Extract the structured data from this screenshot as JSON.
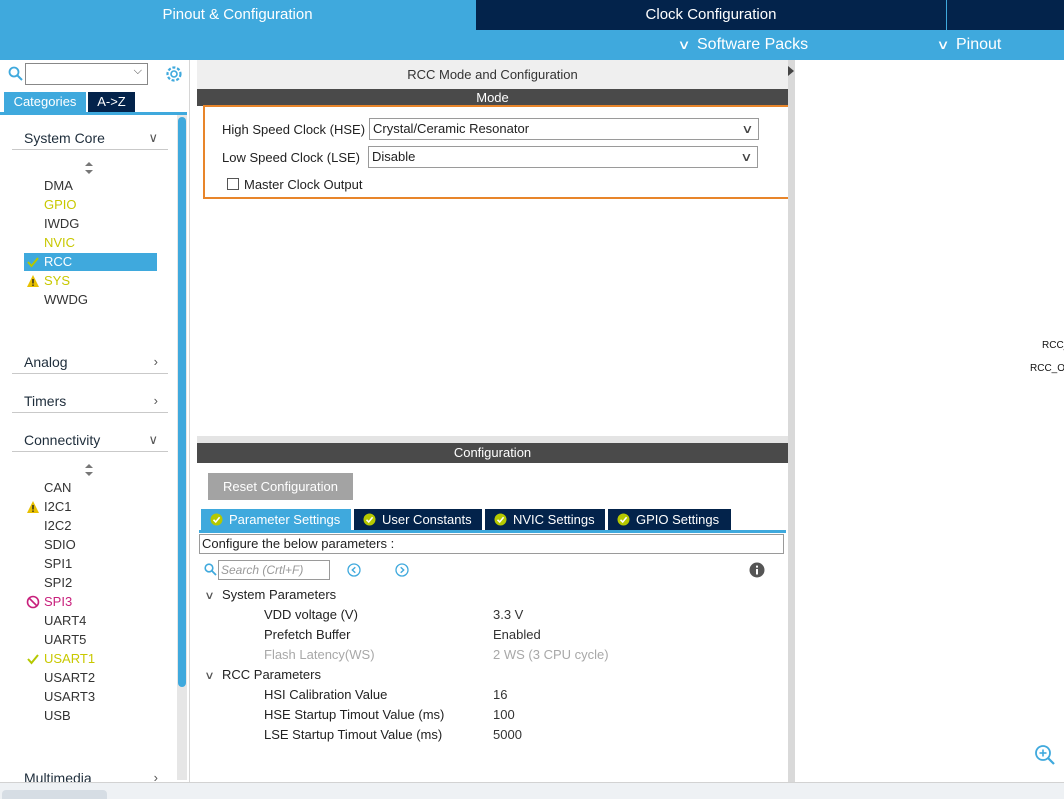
{
  "top_tabs": {
    "pinout": "Pinout & Configuration",
    "clock": "Clock Configuration"
  },
  "subnav": {
    "software_packs": "Software Packs",
    "pinout": "Pinout"
  },
  "left": {
    "categories_tab": "Categories",
    "az_tab": "A->Z",
    "system_core": {
      "title": "System Core",
      "items": [
        "DMA",
        "GPIO",
        "IWDG",
        "NVIC",
        "RCC",
        "SYS",
        "WWDG"
      ]
    },
    "analog": "Analog",
    "timers": "Timers",
    "connectivity": {
      "title": "Connectivity",
      "items": [
        "CAN",
        "I2C1",
        "I2C2",
        "SDIO",
        "SPI1",
        "SPI2",
        "SPI3",
        "UART4",
        "UART5",
        "USART1",
        "USART2",
        "USART3",
        "USB"
      ]
    },
    "multimedia": "Multimedia"
  },
  "mode": {
    "title": "RCC Mode and Configuration",
    "header": "Mode",
    "hse_label": "High Speed Clock (HSE)",
    "hse_value": "Crystal/Ceramic Resonator",
    "lse_label": "Low Speed Clock (LSE)",
    "lse_value": "Disable",
    "mco_label": "Master Clock Output"
  },
  "config": {
    "header": "Configuration",
    "reset": "Reset Configuration",
    "tabs": [
      "Parameter Settings",
      "User Constants",
      "NVIC Settings",
      "GPIO Settings"
    ],
    "hint": "Configure the below parameters :",
    "search_placeholder": "Search (Crtl+F)",
    "groups": [
      {
        "name": "System Parameters",
        "params": [
          {
            "name": "VDD voltage (V)",
            "value": "3.3 V"
          },
          {
            "name": "Prefetch Buffer",
            "value": "Enabled"
          },
          {
            "name": "Flash Latency(WS)",
            "value": "2 WS (3 CPU cycle)"
          }
        ]
      },
      {
        "name": "RCC Parameters",
        "params": [
          {
            "name": "HSI Calibration Value",
            "value": "16"
          },
          {
            "name": "HSE Startup Timout Value (ms)",
            "value": "100"
          },
          {
            "name": "LSE Startup Timout Value (ms)",
            "value": "5000"
          }
        ]
      }
    ]
  },
  "right_labels": [
    "RCC_",
    "RCC_O"
  ],
  "colors": {
    "accent": "#3fa9dd",
    "navy": "#03234b",
    "warning": "#e8c000",
    "ok": "#b5c800",
    "error": "#c8207c",
    "highlight": "#e8852a"
  }
}
